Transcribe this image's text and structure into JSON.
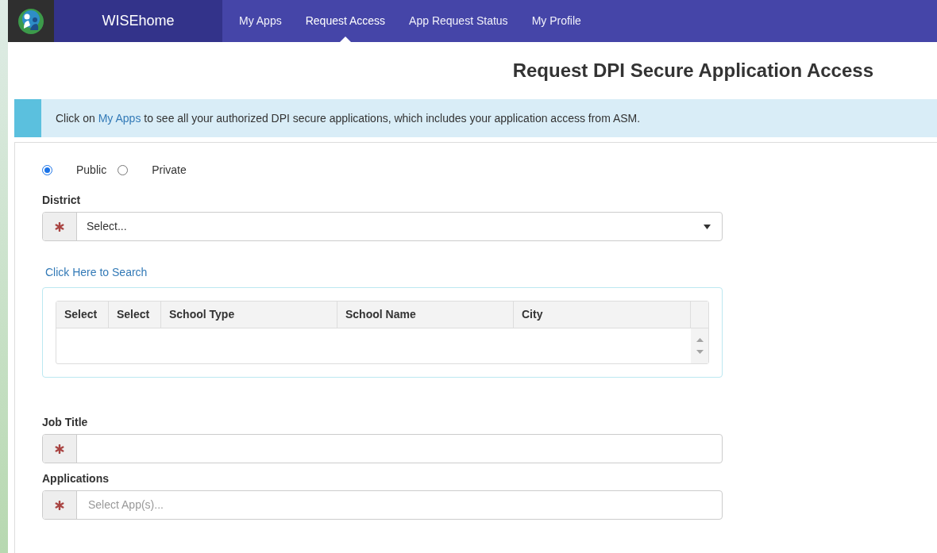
{
  "nav": {
    "brand": "WISEhome",
    "items": [
      {
        "label": "My Apps",
        "selected": false
      },
      {
        "label": "Request Access",
        "selected": true
      },
      {
        "label": "App Request Status",
        "selected": false
      },
      {
        "label": "My Profile",
        "selected": false
      }
    ]
  },
  "page_title": "Request DPI Secure Application Access",
  "info": {
    "before": "Click on ",
    "link": "My Apps",
    "after": " to see all your authorized DPI secure applications, which includes your application access from ASM."
  },
  "school_kind": [
    {
      "label": "Public",
      "selected": true
    },
    {
      "label": "Private",
      "selected": false
    }
  ],
  "district": {
    "label": "District",
    "value": "Select...",
    "required": true
  },
  "search_link": "Click Here to Search",
  "table": {
    "columns": [
      "Select",
      "Select",
      "School Type",
      "School Name",
      "City"
    ]
  },
  "job_title": {
    "label": "Job Title",
    "required": true
  },
  "applications": {
    "label": "Applications",
    "placeholder": "Select App(s)...",
    "required": true
  }
}
